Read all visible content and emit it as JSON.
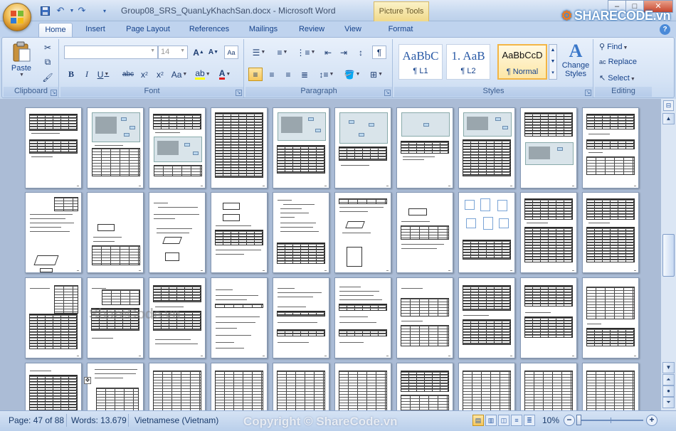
{
  "window": {
    "title": "Group08_SRS_QuanLyKhachSan.docx - Microsoft Word",
    "contextual_tab_group": "Picture Tools",
    "watermark_logo": "SHARECODE.vn",
    "controls": {
      "minimize": "–",
      "maximize": "□",
      "close": "✕"
    }
  },
  "quick_access": {
    "save_icon": "save-icon",
    "undo_icon": "undo-icon",
    "redo_icon": "redo-icon",
    "customize_icon": "customize-icon"
  },
  "tabs": [
    "Home",
    "Insert",
    "Page Layout",
    "References",
    "Mailings",
    "Review",
    "View",
    "Format"
  ],
  "active_tab": "Home",
  "ribbon": {
    "clipboard": {
      "label": "Clipboard",
      "paste": "Paste"
    },
    "font": {
      "label": "Font",
      "font_name": "",
      "font_size": "14"
    },
    "paragraph": {
      "label": "Paragraph"
    },
    "styles": {
      "label": "Styles",
      "items": [
        {
          "sample": "AaBbC",
          "name": "¶ L1"
        },
        {
          "sample": "1.  AaB",
          "name": "¶ L2"
        },
        {
          "sample": "AaBbCcD",
          "name": "¶ Normal"
        }
      ],
      "change_styles": "Change Styles"
    },
    "editing": {
      "label": "Editing",
      "find": "Find",
      "replace": "Replace",
      "select": "Select"
    }
  },
  "document": {
    "watermark": "ShareCode.vn"
  },
  "status": {
    "page": "Page: 47 of 88",
    "words": "Words: 13.679",
    "language": "Vietnamese (Vietnam)",
    "zoom": "10%",
    "copyright": "Copyright © ShareCode.vn"
  },
  "colors": {
    "ribbon_bg": "#d5e3f5",
    "doc_bg": "#abbcd6",
    "selected_style": "#fde7a6"
  }
}
